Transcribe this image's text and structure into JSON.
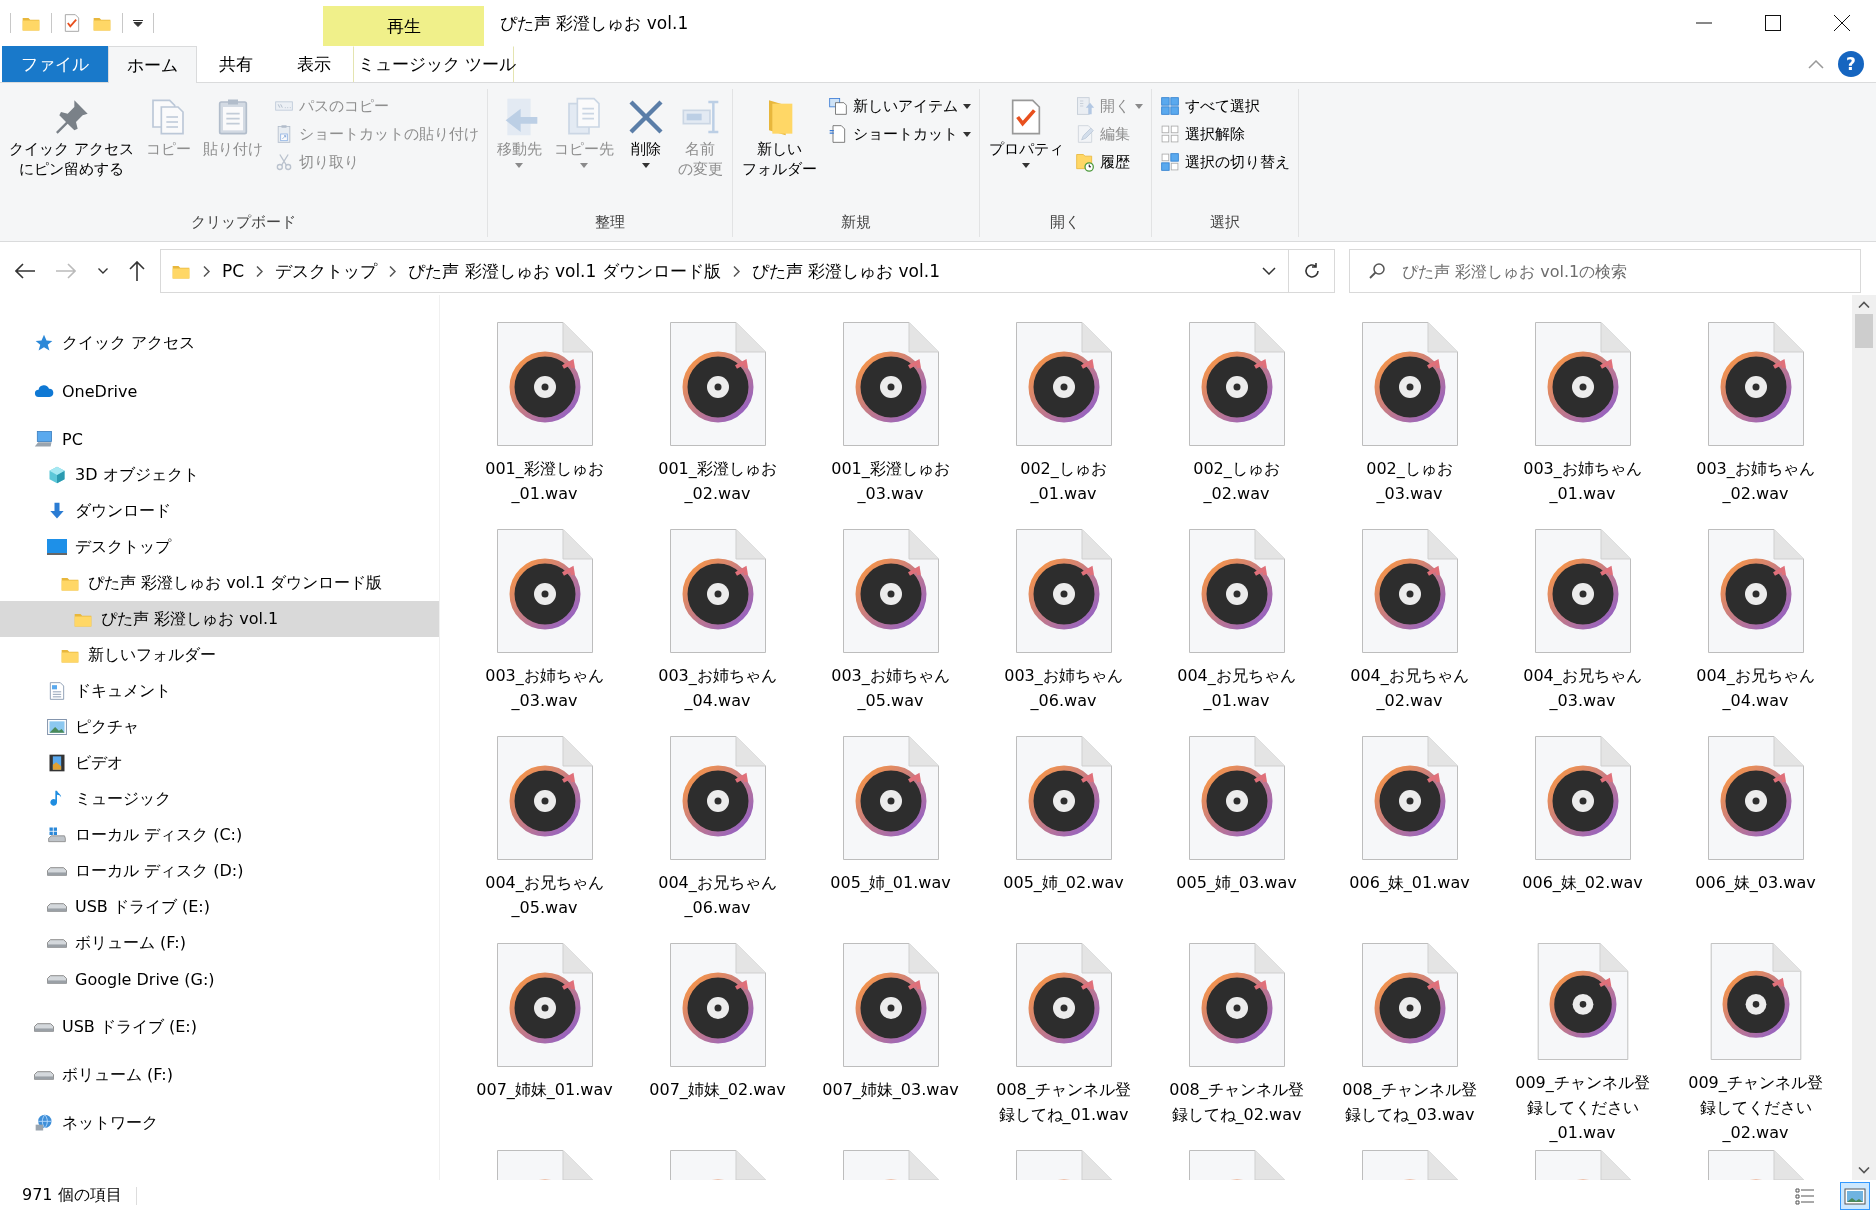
{
  "window": {
    "title": "ぴた声 彩澄しゅお vol.1",
    "context_header": "再生",
    "help_button": "?"
  },
  "ribbon_tabs": [
    {
      "label": "ファイル",
      "kind": "file",
      "selected": false
    },
    {
      "label": "ホーム",
      "kind": "normal",
      "selected": true
    },
    {
      "label": "共有",
      "kind": "normal",
      "selected": false
    },
    {
      "label": "表示",
      "kind": "normal",
      "selected": false
    },
    {
      "label": "ミュージック ツール",
      "kind": "context",
      "selected": false
    }
  ],
  "ribbon_groups": [
    {
      "label": "クリップボード",
      "items": [
        {
          "kind": "large",
          "label": [
            "クイック アクセス",
            "にピン留めする"
          ],
          "disabled": false,
          "dropdown": false
        },
        {
          "kind": "large",
          "label": [
            "コピー"
          ],
          "disabled": true,
          "dropdown": false
        },
        {
          "kind": "large",
          "label": [
            "貼り付け"
          ],
          "disabled": true,
          "dropdown": false
        },
        {
          "kind": "stack",
          "commands": [
            {
              "label": "パスのコピー",
              "disabled": true,
              "dropdown": false
            },
            {
              "label": "ショートカットの貼り付け",
              "disabled": true,
              "dropdown": false
            },
            {
              "label": "切り取り",
              "disabled": true,
              "dropdown": false
            }
          ]
        }
      ]
    },
    {
      "label": "整理",
      "items": [
        {
          "kind": "large",
          "label": [
            "移動先"
          ],
          "disabled": true,
          "dropdown": true
        },
        {
          "kind": "large",
          "label": [
            "コピー先"
          ],
          "disabled": true,
          "dropdown": true
        },
        {
          "kind": "large",
          "label": [
            "削除"
          ],
          "disabled": false,
          "dropdown": true
        },
        {
          "kind": "large",
          "label": [
            "名前",
            "の変更"
          ],
          "disabled": true,
          "dropdown": false
        }
      ]
    },
    {
      "label": "新規",
      "items": [
        {
          "kind": "large",
          "label": [
            "新しい",
            "フォルダー"
          ],
          "disabled": false,
          "dropdown": false
        },
        {
          "kind": "stack",
          "commands": [
            {
              "label": "新しいアイテム",
              "disabled": false,
              "dropdown": true
            },
            {
              "label": "ショートカット",
              "disabled": false,
              "dropdown": true
            }
          ]
        }
      ]
    },
    {
      "label": "開く",
      "items": [
        {
          "kind": "large",
          "label": [
            "プロパティ"
          ],
          "disabled": false,
          "dropdown": true
        },
        {
          "kind": "stack",
          "commands": [
            {
              "label": "開く",
              "disabled": true,
              "dropdown": true
            },
            {
              "label": "編集",
              "disabled": true,
              "dropdown": false
            },
            {
              "label": "履歴",
              "disabled": false,
              "dropdown": false
            }
          ]
        }
      ]
    },
    {
      "label": "選択",
      "items": [
        {
          "kind": "stack",
          "commands": [
            {
              "label": "すべて選択",
              "disabled": false,
              "dropdown": false
            },
            {
              "label": "選択解除",
              "disabled": false,
              "dropdown": false
            },
            {
              "label": "選択の切り替え",
              "disabled": false,
              "dropdown": false
            }
          ]
        }
      ]
    }
  ],
  "address_bar": {
    "breadcrumbs": [
      "PC",
      "デスクトップ",
      "ぴた声 彩澄しゅお vol.1 ダウンロード版",
      "ぴた声 彩澄しゅお vol.1"
    ]
  },
  "search": {
    "placeholder": "ぴた声 彩澄しゅお vol.1の検索"
  },
  "navigation_pane": [
    {
      "label": "クイック アクセス",
      "kind": "quick_access",
      "selected": false
    },
    {
      "label": "OneDrive",
      "kind": "cloud",
      "selected": false
    },
    {
      "label": "PC",
      "kind": "pc",
      "selected": false,
      "children": [
        {
          "label": "3D オブジェクト",
          "kind": "objects_3d",
          "selected": false
        },
        {
          "label": "ダウンロード",
          "kind": "downloads",
          "selected": false
        },
        {
          "label": "デスクトップ",
          "kind": "desktop",
          "selected": false,
          "children": [
            {
              "label": "ぴた声 彩澄しゅお vol.1 ダウンロード版",
              "kind": "folder",
              "selected": false,
              "children": [
                {
                  "label": "ぴた声 彩澄しゅお vol.1",
                  "kind": "folder",
                  "selected": true
                }
              ]
            },
            {
              "label": "新しいフォルダー",
              "kind": "folder",
              "selected": false
            }
          ]
        },
        {
          "label": "ドキュメント",
          "kind": "documents",
          "selected": false
        },
        {
          "label": "ピクチャ",
          "kind": "pictures",
          "selected": false
        },
        {
          "label": "ビデオ",
          "kind": "videos",
          "selected": false
        },
        {
          "label": "ミュージック",
          "kind": "music",
          "selected": false
        },
        {
          "label": "ローカル ディスク (C:)",
          "kind": "system_drive",
          "selected": false
        },
        {
          "label": "ローカル ディスク (D:)",
          "kind": "drive",
          "selected": false
        },
        {
          "label": "USB ドライブ (E:)",
          "kind": "drive",
          "selected": false
        },
        {
          "label": "ボリューム (F:)",
          "kind": "drive",
          "selected": false
        },
        {
          "label": "Google Drive (G:)",
          "kind": "drive",
          "selected": false
        }
      ]
    },
    {
      "label": "USB ドライブ (E:)",
      "kind": "drive",
      "selected": false
    },
    {
      "label": "ボリューム (F:)",
      "kind": "drive",
      "selected": false
    },
    {
      "label": "ネットワーク",
      "kind": "network",
      "selected": false
    }
  ],
  "files": [
    {
      "name": "001_彩澄しゅお_01.wav",
      "kind": "wav"
    },
    {
      "name": "001_彩澄しゅお_02.wav",
      "kind": "wav"
    },
    {
      "name": "001_彩澄しゅお_03.wav",
      "kind": "wav"
    },
    {
      "name": "002_しゅお_01.wav",
      "kind": "wav"
    },
    {
      "name": "002_しゅお_02.wav",
      "kind": "wav"
    },
    {
      "name": "002_しゅお_03.wav",
      "kind": "wav"
    },
    {
      "name": "003_お姉ちゃん_01.wav",
      "kind": "wav"
    },
    {
      "name": "003_お姉ちゃん_02.wav",
      "kind": "wav"
    },
    {
      "name": "003_お姉ちゃん_03.wav",
      "kind": "wav"
    },
    {
      "name": "003_お姉ちゃん_04.wav",
      "kind": "wav"
    },
    {
      "name": "003_お姉ちゃん_05.wav",
      "kind": "wav"
    },
    {
      "name": "003_お姉ちゃん_06.wav",
      "kind": "wav"
    },
    {
      "name": "004_お兄ちゃん_01.wav",
      "kind": "wav"
    },
    {
      "name": "004_お兄ちゃん_02.wav",
      "kind": "wav"
    },
    {
      "name": "004_お兄ちゃん_03.wav",
      "kind": "wav"
    },
    {
      "name": "004_お兄ちゃん_04.wav",
      "kind": "wav"
    },
    {
      "name": "004_お兄ちゃん_05.wav",
      "kind": "wav"
    },
    {
      "name": "004_お兄ちゃん_06.wav",
      "kind": "wav"
    },
    {
      "name": "005_姉_01.wav",
      "kind": "wav"
    },
    {
      "name": "005_姉_02.wav",
      "kind": "wav"
    },
    {
      "name": "005_姉_03.wav",
      "kind": "wav"
    },
    {
      "name": "006_妹_01.wav",
      "kind": "wav"
    },
    {
      "name": "006_妹_02.wav",
      "kind": "wav"
    },
    {
      "name": "006_妹_03.wav",
      "kind": "wav"
    },
    {
      "name": "007_姉妹_01.wav",
      "kind": "wav"
    },
    {
      "name": "007_姉妹_02.wav",
      "kind": "wav"
    },
    {
      "name": "007_姉妹_03.wav",
      "kind": "wav"
    },
    {
      "name": "008_チャンネル登録してね_01.wav",
      "kind": "wav"
    },
    {
      "name": "008_チャンネル登録してね_02.wav",
      "kind": "wav"
    },
    {
      "name": "008_チャンネル登録してね_03.wav",
      "kind": "wav"
    },
    {
      "name": "009_チャンネル登録してください_01.wav",
      "kind": "wav"
    },
    {
      "name": "009_チャンネル登録してください_02.wav",
      "kind": "wav"
    },
    {
      "kind": "wav"
    },
    {
      "kind": "wav"
    },
    {
      "kind": "wav"
    },
    {
      "kind": "wav"
    },
    {
      "kind": "wav"
    },
    {
      "kind": "wav"
    },
    {
      "kind": "wav"
    },
    {
      "kind": "wav"
    }
  ],
  "status_bar": {
    "item_count": "971 個の項目",
    "view_modes": [
      {
        "kind": "details",
        "selected": false
      },
      {
        "kind": "large_icons",
        "selected": true
      }
    ]
  }
}
